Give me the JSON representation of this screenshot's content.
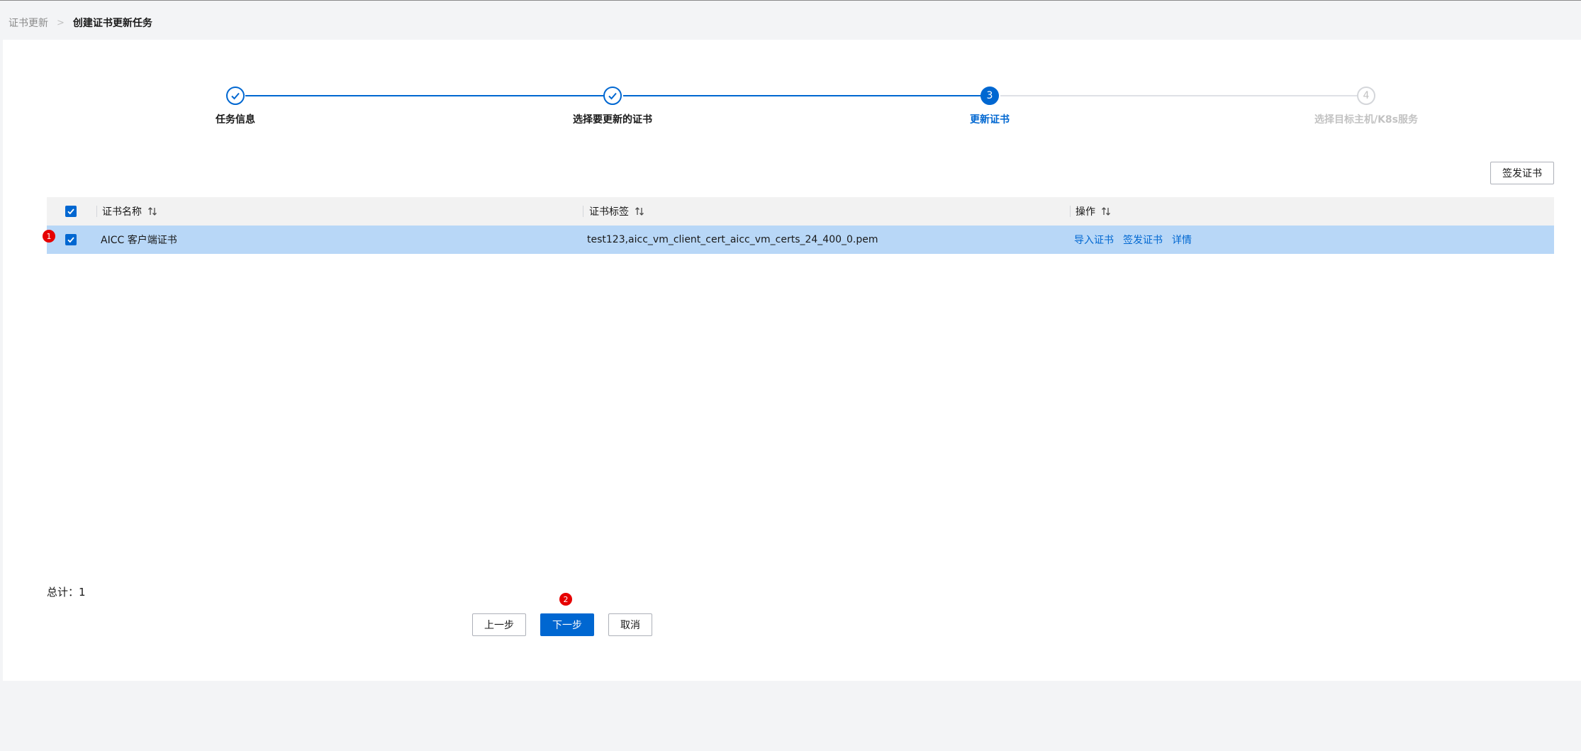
{
  "breadcrumb": {
    "parent": "证书更新",
    "separator": ">",
    "current": "创建证书更新任务"
  },
  "steps": [
    {
      "number": "1",
      "label": "任务信息",
      "status": "done"
    },
    {
      "number": "2",
      "label": "选择要更新的证书",
      "status": "done"
    },
    {
      "number": "3",
      "label": "更新证书",
      "status": "active"
    },
    {
      "number": "4",
      "label": "选择目标主机/K8s服务",
      "status": "todo"
    }
  ],
  "toolbar": {
    "issue_button": "签发证书"
  },
  "table": {
    "headers": {
      "name": "证书名称",
      "label": "证书标签",
      "actions": "操作"
    },
    "rows": [
      {
        "checked": true,
        "name": "AICC 客户端证书",
        "label": "test123,aicc_vm_client_cert_aicc_vm_certs_24_400_0.pem",
        "actions": [
          "导入证书",
          "签发证书",
          "详情"
        ]
      }
    ]
  },
  "annotations": {
    "badge1": "1",
    "badge2": "2"
  },
  "footer": {
    "total_label": "总计：",
    "total_value": "1"
  },
  "buttons": {
    "prev": "上一步",
    "next": "下一步",
    "cancel": "取消"
  },
  "colors": {
    "primary": "#0067d1",
    "row_selected": "#b8d7f7",
    "badge": "#e60000"
  }
}
